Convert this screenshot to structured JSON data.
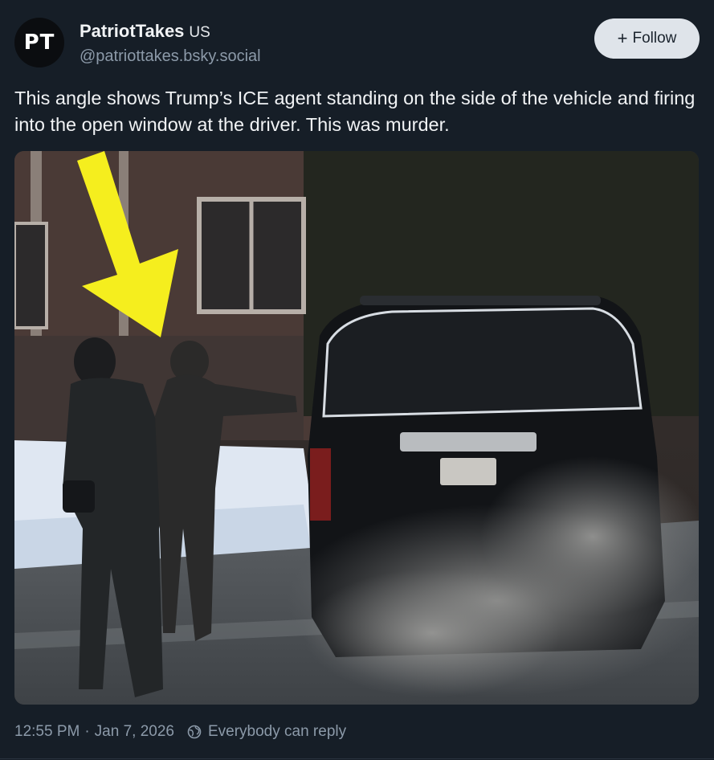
{
  "author": {
    "avatar_initials": "PT",
    "display_name": "PatriotTakes",
    "suffix": "US",
    "handle": "@patriottakes.bsky.social"
  },
  "follow_button": {
    "icon": "plus-icon",
    "label": "Follow"
  },
  "post": {
    "text": "This angle shows Trump’s ICE agent standing on the side of the vehicle and firing into the open window at the driver. This was murder."
  },
  "media": {
    "alt": "Photo of two agents standing beside a dark SUV with exhaust smoke on a snowy street, a yellow arrow pointing at one agent",
    "arrow_color": "#f5ee1e"
  },
  "footer": {
    "time": "12:55 PM",
    "separator": "·",
    "date": "Jan 7, 2026",
    "reply_icon": "globe-reply-icon",
    "reply_setting": "Everybody can reply"
  },
  "colors": {
    "background": "#161e27",
    "text": "#f1f3f5",
    "muted": "#8c9aa9",
    "button_bg": "#dfe4ea"
  }
}
